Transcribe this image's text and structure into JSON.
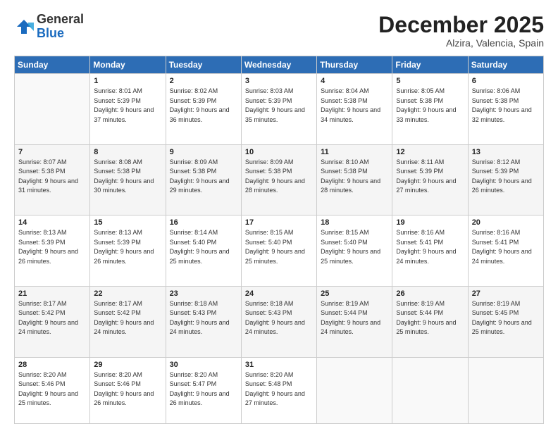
{
  "logo": {
    "general": "General",
    "blue": "Blue"
  },
  "header": {
    "month": "December 2025",
    "location": "Alzira, Valencia, Spain"
  },
  "weekdays": [
    "Sunday",
    "Monday",
    "Tuesday",
    "Wednesday",
    "Thursday",
    "Friday",
    "Saturday"
  ],
  "weeks": [
    [
      {
        "day": "",
        "sunrise": "",
        "sunset": "",
        "daylight": ""
      },
      {
        "day": "1",
        "sunrise": "Sunrise: 8:01 AM",
        "sunset": "Sunset: 5:39 PM",
        "daylight": "Daylight: 9 hours and 37 minutes."
      },
      {
        "day": "2",
        "sunrise": "Sunrise: 8:02 AM",
        "sunset": "Sunset: 5:39 PM",
        "daylight": "Daylight: 9 hours and 36 minutes."
      },
      {
        "day": "3",
        "sunrise": "Sunrise: 8:03 AM",
        "sunset": "Sunset: 5:39 PM",
        "daylight": "Daylight: 9 hours and 35 minutes."
      },
      {
        "day": "4",
        "sunrise": "Sunrise: 8:04 AM",
        "sunset": "Sunset: 5:38 PM",
        "daylight": "Daylight: 9 hours and 34 minutes."
      },
      {
        "day": "5",
        "sunrise": "Sunrise: 8:05 AM",
        "sunset": "Sunset: 5:38 PM",
        "daylight": "Daylight: 9 hours and 33 minutes."
      },
      {
        "day": "6",
        "sunrise": "Sunrise: 8:06 AM",
        "sunset": "Sunset: 5:38 PM",
        "daylight": "Daylight: 9 hours and 32 minutes."
      }
    ],
    [
      {
        "day": "7",
        "sunrise": "Sunrise: 8:07 AM",
        "sunset": "Sunset: 5:38 PM",
        "daylight": "Daylight: 9 hours and 31 minutes."
      },
      {
        "day": "8",
        "sunrise": "Sunrise: 8:08 AM",
        "sunset": "Sunset: 5:38 PM",
        "daylight": "Daylight: 9 hours and 30 minutes."
      },
      {
        "day": "9",
        "sunrise": "Sunrise: 8:09 AM",
        "sunset": "Sunset: 5:38 PM",
        "daylight": "Daylight: 9 hours and 29 minutes."
      },
      {
        "day": "10",
        "sunrise": "Sunrise: 8:09 AM",
        "sunset": "Sunset: 5:38 PM",
        "daylight": "Daylight: 9 hours and 28 minutes."
      },
      {
        "day": "11",
        "sunrise": "Sunrise: 8:10 AM",
        "sunset": "Sunset: 5:38 PM",
        "daylight": "Daylight: 9 hours and 28 minutes."
      },
      {
        "day": "12",
        "sunrise": "Sunrise: 8:11 AM",
        "sunset": "Sunset: 5:39 PM",
        "daylight": "Daylight: 9 hours and 27 minutes."
      },
      {
        "day": "13",
        "sunrise": "Sunrise: 8:12 AM",
        "sunset": "Sunset: 5:39 PM",
        "daylight": "Daylight: 9 hours and 26 minutes."
      }
    ],
    [
      {
        "day": "14",
        "sunrise": "Sunrise: 8:13 AM",
        "sunset": "Sunset: 5:39 PM",
        "daylight": "Daylight: 9 hours and 26 minutes."
      },
      {
        "day": "15",
        "sunrise": "Sunrise: 8:13 AM",
        "sunset": "Sunset: 5:39 PM",
        "daylight": "Daylight: 9 hours and 26 minutes."
      },
      {
        "day": "16",
        "sunrise": "Sunrise: 8:14 AM",
        "sunset": "Sunset: 5:40 PM",
        "daylight": "Daylight: 9 hours and 25 minutes."
      },
      {
        "day": "17",
        "sunrise": "Sunrise: 8:15 AM",
        "sunset": "Sunset: 5:40 PM",
        "daylight": "Daylight: 9 hours and 25 minutes."
      },
      {
        "day": "18",
        "sunrise": "Sunrise: 8:15 AM",
        "sunset": "Sunset: 5:40 PM",
        "daylight": "Daylight: 9 hours and 25 minutes."
      },
      {
        "day": "19",
        "sunrise": "Sunrise: 8:16 AM",
        "sunset": "Sunset: 5:41 PM",
        "daylight": "Daylight: 9 hours and 24 minutes."
      },
      {
        "day": "20",
        "sunrise": "Sunrise: 8:16 AM",
        "sunset": "Sunset: 5:41 PM",
        "daylight": "Daylight: 9 hours and 24 minutes."
      }
    ],
    [
      {
        "day": "21",
        "sunrise": "Sunrise: 8:17 AM",
        "sunset": "Sunset: 5:42 PM",
        "daylight": "Daylight: 9 hours and 24 minutes."
      },
      {
        "day": "22",
        "sunrise": "Sunrise: 8:17 AM",
        "sunset": "Sunset: 5:42 PM",
        "daylight": "Daylight: 9 hours and 24 minutes."
      },
      {
        "day": "23",
        "sunrise": "Sunrise: 8:18 AM",
        "sunset": "Sunset: 5:43 PM",
        "daylight": "Daylight: 9 hours and 24 minutes."
      },
      {
        "day": "24",
        "sunrise": "Sunrise: 8:18 AM",
        "sunset": "Sunset: 5:43 PM",
        "daylight": "Daylight: 9 hours and 24 minutes."
      },
      {
        "day": "25",
        "sunrise": "Sunrise: 8:19 AM",
        "sunset": "Sunset: 5:44 PM",
        "daylight": "Daylight: 9 hours and 24 minutes."
      },
      {
        "day": "26",
        "sunrise": "Sunrise: 8:19 AM",
        "sunset": "Sunset: 5:44 PM",
        "daylight": "Daylight: 9 hours and 25 minutes."
      },
      {
        "day": "27",
        "sunrise": "Sunrise: 8:19 AM",
        "sunset": "Sunset: 5:45 PM",
        "daylight": "Daylight: 9 hours and 25 minutes."
      }
    ],
    [
      {
        "day": "28",
        "sunrise": "Sunrise: 8:20 AM",
        "sunset": "Sunset: 5:46 PM",
        "daylight": "Daylight: 9 hours and 25 minutes."
      },
      {
        "day": "29",
        "sunrise": "Sunrise: 8:20 AM",
        "sunset": "Sunset: 5:46 PM",
        "daylight": "Daylight: 9 hours and 26 minutes."
      },
      {
        "day": "30",
        "sunrise": "Sunrise: 8:20 AM",
        "sunset": "Sunset: 5:47 PM",
        "daylight": "Daylight: 9 hours and 26 minutes."
      },
      {
        "day": "31",
        "sunrise": "Sunrise: 8:20 AM",
        "sunset": "Sunset: 5:48 PM",
        "daylight": "Daylight: 9 hours and 27 minutes."
      },
      {
        "day": "",
        "sunrise": "",
        "sunset": "",
        "daylight": ""
      },
      {
        "day": "",
        "sunrise": "",
        "sunset": "",
        "daylight": ""
      },
      {
        "day": "",
        "sunrise": "",
        "sunset": "",
        "daylight": ""
      }
    ]
  ]
}
